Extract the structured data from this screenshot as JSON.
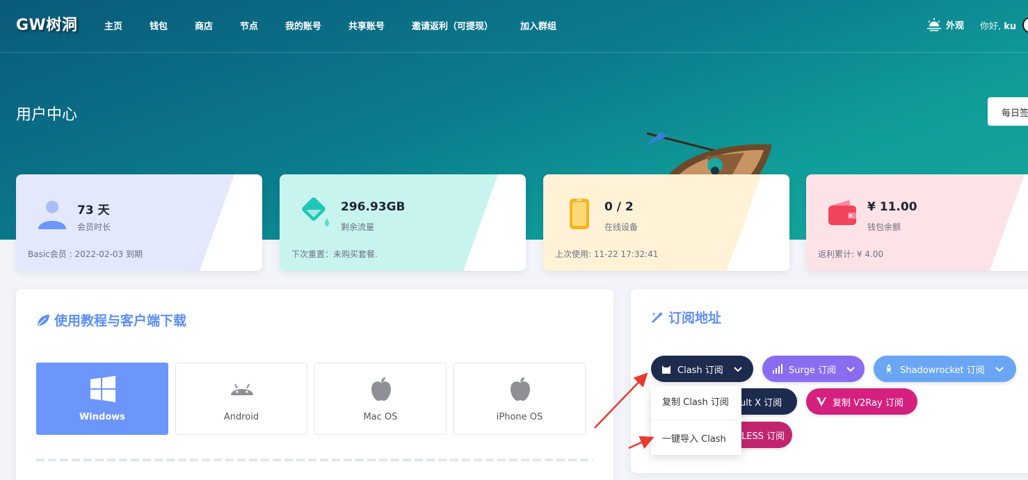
{
  "brand": {
    "logo": "GW树洞"
  },
  "nav": {
    "items": [
      "主页",
      "钱包",
      "商店",
      "节点",
      "我的账号",
      "共享账号",
      "邀请返利（可提现）",
      "加入群组"
    ],
    "appearance": "外观",
    "greeting_prefix": "你好,",
    "username": "ku"
  },
  "header": {
    "title": "用户中心",
    "checkin_label": "每日签"
  },
  "stats": [
    {
      "value": "73 天",
      "label": "会员时长",
      "footer": "Basic会员 : 2022-02-03 到期",
      "icon": "user-icon",
      "bg": "#e3e8fd",
      "accent": "#6c96fb"
    },
    {
      "value": "296.93GB",
      "label": "剩余流量",
      "footer": "下次重置：未购买套餐.",
      "icon": "water-drop-icon",
      "bg": "#c8f4f0",
      "accent": "#1fc7b8"
    },
    {
      "value": "0 / 2",
      "label": "在线设备",
      "footer": "上次使用: 11-22 17:32:41",
      "icon": "phone-icon",
      "bg": "#fff2d6",
      "accent": "#f8b320"
    },
    {
      "value": "¥ 11.00",
      "label": "钱包余额",
      "footer": "返利累计: ¥ 4.00",
      "icon": "wallet-icon",
      "bg": "#fde3e7",
      "accent": "#f3445d"
    }
  ],
  "tutorial": {
    "title": "使用教程与客户端下载",
    "os_tabs": [
      {
        "label": "Windows",
        "icon": "windows-icon",
        "active": true
      },
      {
        "label": "Android",
        "icon": "android-icon",
        "active": false
      },
      {
        "label": "Mac OS",
        "icon": "apple-icon",
        "active": false
      },
      {
        "label": "iPhone OS",
        "icon": "apple-icon",
        "active": false
      }
    ]
  },
  "subscribe": {
    "title": "订阅地址",
    "buttons": {
      "clash": "Clash 订阅",
      "surge": "Surge 订阅",
      "shadowrocket": "Shadowrocket 订阅",
      "quantumult": "ult X 订阅",
      "v2ray": "复制 V2Ray 订阅",
      "vless": "LESS 订阅"
    },
    "dropdown": [
      "复制 Clash 订阅",
      "一键导入 Clash"
    ]
  },
  "colors": {
    "primary": "#6c96fb",
    "clash": "#1c2b4e",
    "surge": "#8a6cf0",
    "shadowrocket": "#6aa6f3",
    "v2ray": "#d4207e",
    "vless": "#c2256f",
    "annotation": "#e8392f"
  }
}
